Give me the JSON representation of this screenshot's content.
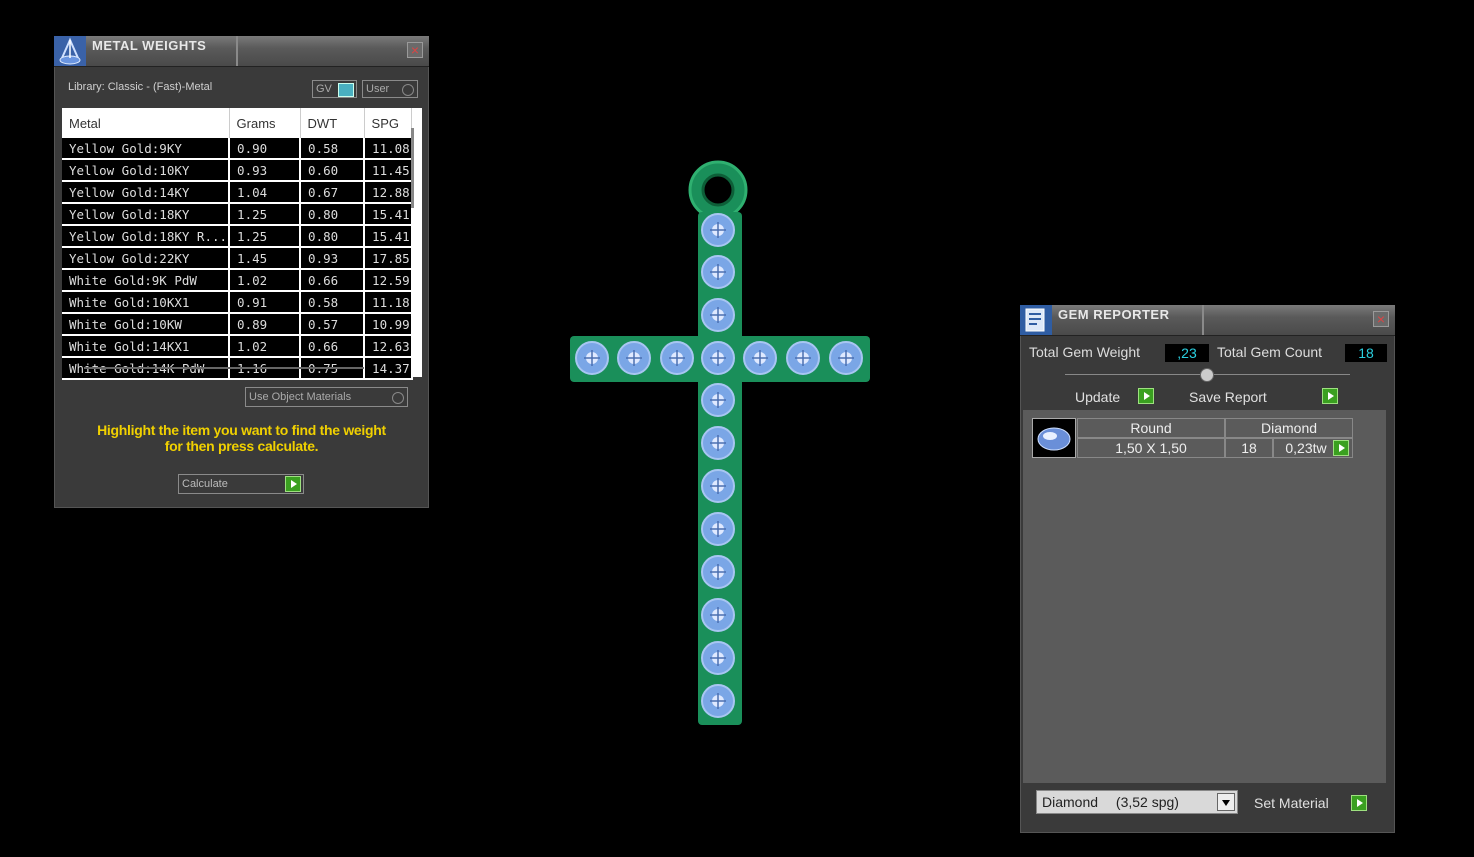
{
  "metal_weights": {
    "title": "METAL WEIGHTS",
    "library_label": "Library: Classic - (Fast)-Metal",
    "gv_label": "GV",
    "user_label": "User",
    "columns": [
      "Metal",
      "Grams",
      "DWT",
      "SPG"
    ],
    "rows": [
      [
        "Yellow Gold:9KY",
        "0.90",
        "0.58",
        "11.08"
      ],
      [
        "Yellow Gold:10KY",
        "0.93",
        "0.60",
        "11.45"
      ],
      [
        "Yellow Gold:14KY",
        "1.04",
        "0.67",
        "12.88"
      ],
      [
        "Yellow Gold:18KY",
        "1.25",
        "0.80",
        "15.41"
      ],
      [
        "Yellow Gold:18KY R...",
        "1.25",
        "0.80",
        "15.41"
      ],
      [
        "Yellow Gold:22KY",
        "1.45",
        "0.93",
        "17.85"
      ],
      [
        "White Gold:9K PdW",
        "1.02",
        "0.66",
        "12.59"
      ],
      [
        "White Gold:10KX1",
        "0.91",
        "0.58",
        "11.18"
      ],
      [
        "White Gold:10KW",
        "0.89",
        "0.57",
        "10.99"
      ],
      [
        "White Gold:14KX1",
        "1.02",
        "0.66",
        "12.63"
      ],
      [
        "White Gold:14K PdW",
        "1.16",
        "0.75",
        "14.37"
      ]
    ],
    "use_object_materials_label": "Use Object Materials",
    "hint_line1": "Highlight the item you want to find the weight",
    "hint_line2": "for then press calculate.",
    "calculate_label": "Calculate"
  },
  "gem_reporter": {
    "title": "GEM REPORTER",
    "total_weight_label": "Total Gem Weight",
    "total_weight_value": ",23",
    "total_count_label": "Total Gem Count",
    "total_count_value": "18",
    "update_label": "Update",
    "save_report_label": "Save Report",
    "gem_rows": [
      {
        "shape": "Round",
        "material": "Diamond",
        "size": "1,50 X 1,50",
        "count": "18",
        "weight": "0,23tw"
      }
    ],
    "material_select_name": "Diamond",
    "material_select_spg": "(3,52 spg)",
    "set_material_label": "Set Material"
  },
  "colors": {
    "cross_green": "#1a8f5a",
    "gem_blue": "#7aa6e6",
    "value_cyan": "#2ad0e0",
    "hint_yellow": "#f0d000"
  }
}
